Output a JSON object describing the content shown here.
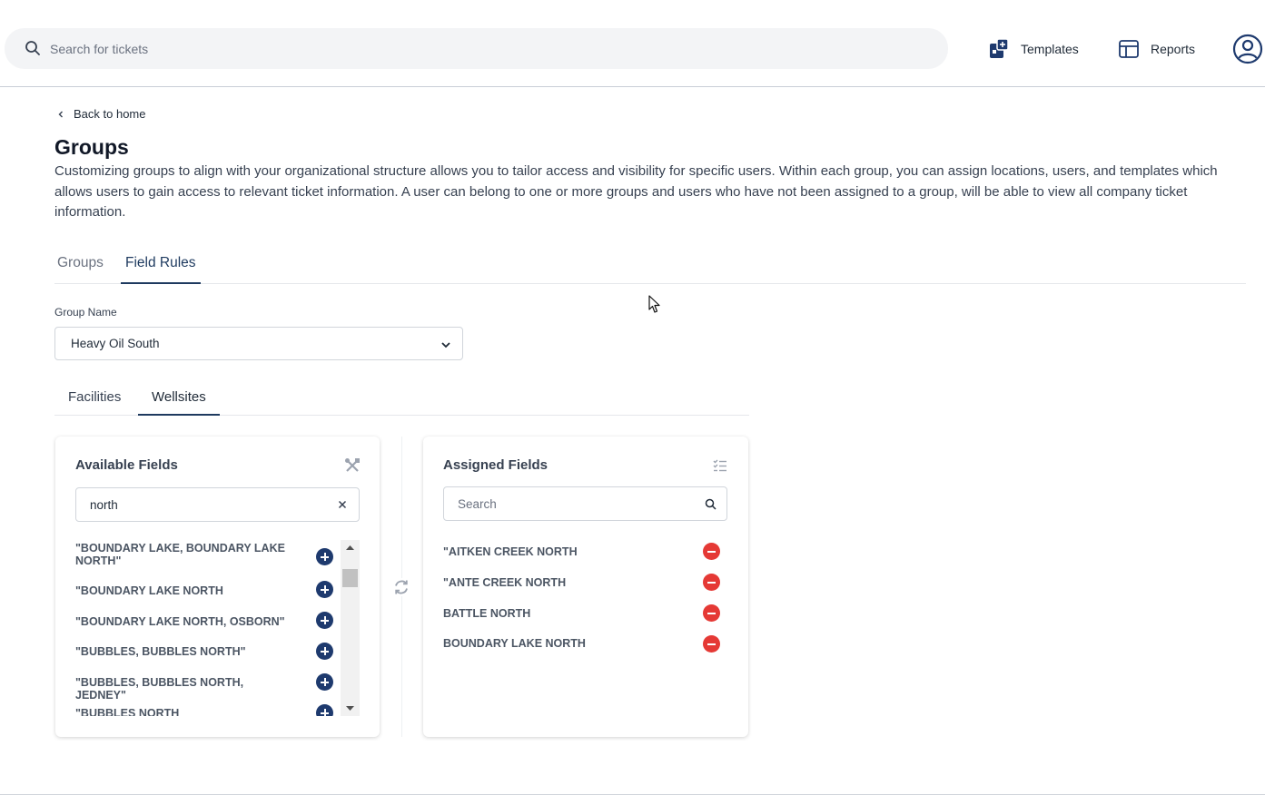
{
  "header": {
    "search_placeholder": "Search for tickets",
    "templates_label": "Templates",
    "reports_label": "Reports"
  },
  "page": {
    "back_label": "Back to home",
    "title": "Groups",
    "description": "Customizing groups to align with your organizational structure allows you to tailor access and visibility for specific users. Within each group, you can assign locations, users, and templates which allows users to gain access to relevant ticket information. A user can belong to one or more groups and users who have not been assigned to a group, will be able to view all company ticket information."
  },
  "tabs": [
    {
      "label": "Groups",
      "active": false
    },
    {
      "label": "Field Rules",
      "active": true
    }
  ],
  "group_select": {
    "label": "Group Name",
    "value": "Heavy Oil South"
  },
  "subtabs": [
    {
      "label": "Facilities",
      "active": false
    },
    {
      "label": "Wellsites",
      "active": true
    }
  ],
  "available": {
    "title": "Available Fields",
    "search_value": "north",
    "items": [
      "\"BOUNDARY LAKE, BOUNDARY LAKE NORTH\"",
      "\"BOUNDARY LAKE NORTH",
      "\"BOUNDARY LAKE NORTH, OSBORN\"",
      "\"BUBBLES, BUBBLES NORTH\"",
      "\"BUBBLES, BUBBLES NORTH, JEDNEY\"",
      "\"BUBBLES NORTH"
    ]
  },
  "assigned": {
    "title": "Assigned Fields",
    "search_placeholder": "Search",
    "items": [
      "\"AITKEN CREEK NORTH",
      "\"ANTE CREEK NORTH",
      "BATTLE NORTH",
      "BOUNDARY LAKE NORTH"
    ]
  },
  "colors": {
    "primary": "#1e3a6e",
    "danger": "#e53935",
    "active_tab": "#1e3a5f"
  }
}
